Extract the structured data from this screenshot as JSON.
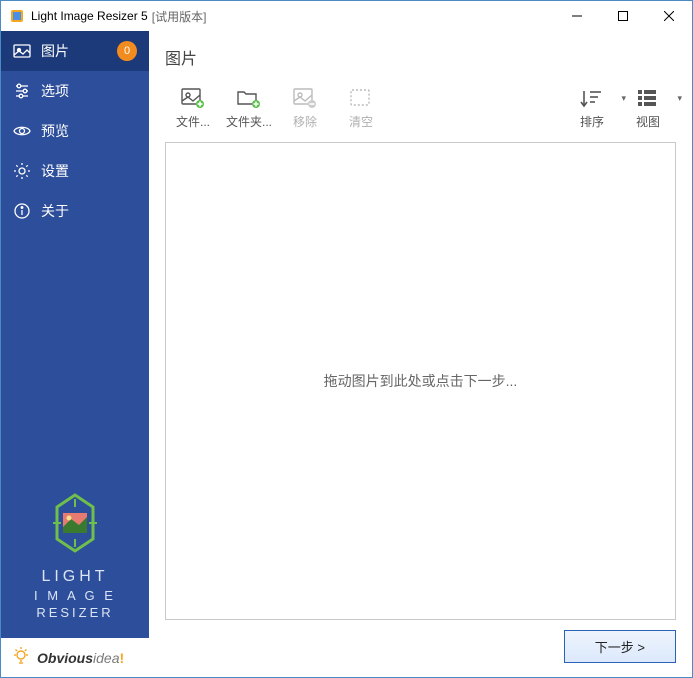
{
  "titlebar": {
    "app_name": "Light Image Resizer 5",
    "edition": "[试用版本]"
  },
  "sidebar": {
    "items": [
      {
        "label": "图片",
        "badge": "0"
      },
      {
        "label": "选项"
      },
      {
        "label": "预览"
      },
      {
        "label": "设置"
      },
      {
        "label": "关于"
      }
    ],
    "product_line1": "LIGHT",
    "product_line2": "I M A G E",
    "product_line3": "RESIZER"
  },
  "footer": {
    "brand_prefix": "Obvious",
    "brand_suffix": "idea",
    "brand_punct": "!"
  },
  "main": {
    "heading": "图片",
    "toolbar": {
      "files": "文件...",
      "folder": "文件夹...",
      "remove": "移除",
      "clear": "清空",
      "sort": "排序",
      "view": "视图"
    },
    "drop_hint": "拖动图片到此处或点击下一步...",
    "next": "下一步 >"
  }
}
